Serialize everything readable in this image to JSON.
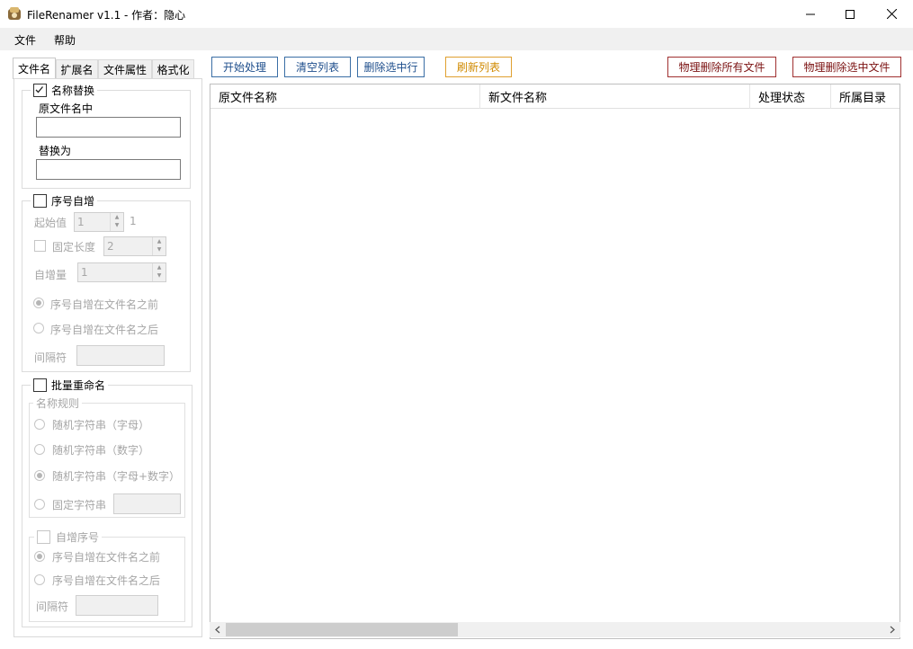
{
  "window": {
    "title": "FileRenamer v1.1 - 作者：隐心",
    "controls": {
      "minimize": "—",
      "maximize": "☐",
      "close": "✕"
    }
  },
  "menu": {
    "file": "文件",
    "help": "帮助"
  },
  "tabs": [
    "文件名",
    "扩展名",
    "文件属性",
    "格式化"
  ],
  "name_replace": {
    "title": "名称替换",
    "checked": true,
    "original_label": "原文件名中",
    "original_value": "",
    "replace_label": "替换为",
    "replace_value": ""
  },
  "serial": {
    "title": "序号自增",
    "start_label": "起始值",
    "start_value": "1",
    "start_preview": "1",
    "fixed_length_label": "固定长度",
    "fixed_length_value": "2",
    "increment_label": "自增量",
    "increment_value": "1",
    "before_label": "序号自增在文件名之前",
    "after_label": "序号自增在文件名之后",
    "separator_label": "间隔符",
    "separator_value": ""
  },
  "batch": {
    "title": "批量重命名",
    "rules_title": "名称规则",
    "opt_letters": "随机字符串（字母）",
    "opt_digits": "随机字符串（数字）",
    "opt_mixed": "随机字符串（字母+数字）",
    "opt_fixed": "固定字符串",
    "fixed_value": "",
    "auto_serial_title": "自增序号",
    "serial_before": "序号自增在文件名之前",
    "serial_after": "序号自增在文件名之后",
    "separator_label": "间隔符",
    "separator_value": ""
  },
  "toolbar": {
    "start": "开始处理",
    "clear": "清空列表",
    "delete_rows": "删除选中行",
    "refresh": "刷新列表",
    "delete_all_files": "物理删除所有文件",
    "delete_selected_files": "物理删除选中文件"
  },
  "list": {
    "columns": [
      "原文件名称",
      "新文件名称",
      "处理状态",
      "所属目录"
    ],
    "rows": []
  },
  "colors": {
    "blue_button": "#3a6ea5",
    "orange_button": "#e0a030",
    "red_button": "#a03030"
  }
}
